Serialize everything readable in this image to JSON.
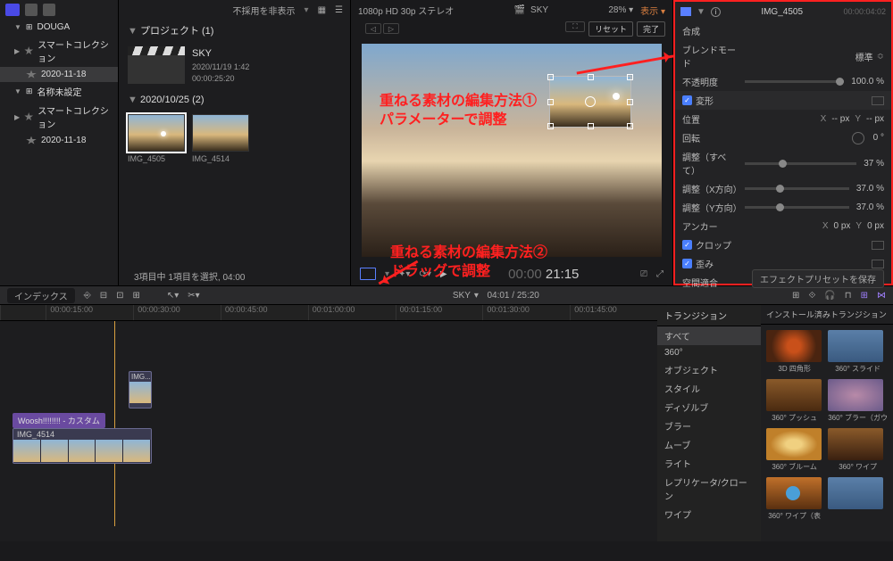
{
  "sidebar": {
    "library": "DOUGA",
    "items": [
      {
        "label": "スマートコレクション",
        "icon": "star"
      },
      {
        "label": "2020-11-18",
        "icon": "star",
        "selected": true
      }
    ],
    "library2": "名称未設定",
    "items2": [
      {
        "label": "スマートコレクション",
        "icon": "star"
      },
      {
        "label": "2020-11-18",
        "icon": "star"
      }
    ]
  },
  "browser": {
    "filter": "不採用を非表示",
    "proj_header": "プロジェクト  (1)",
    "project": {
      "name": "SKY",
      "date": "2020/11/19 1:42",
      "duration": "00:00:25:20"
    },
    "event_header": "2020/10/25  (2)",
    "clips": [
      {
        "name": "IMG_4505",
        "selected": true
      },
      {
        "name": "IMG_4514"
      }
    ],
    "footer": "3項目中 1項目を選択, 04:00"
  },
  "viewer": {
    "format": "1080p HD 30p ステレオ",
    "title": "SKY",
    "zoom": "28%",
    "display_menu": "表示",
    "btn_reset": "リセット",
    "btn_done": "完了",
    "timecode": "21:15",
    "playtime": "00:00",
    "annotation1_l1": "重ねる素材の編集方法①",
    "annotation1_l2": "パラメーターで調整",
    "annotation2_l1": "重ねる素材の編集方法②",
    "annotation2_l2": "ドラッグで調整"
  },
  "inspector": {
    "title": "IMG_4505",
    "timecode": "00:00:04:02",
    "sec_compose": "合成",
    "blend_mode_lbl": "ブレンドモード",
    "blend_mode_val": "標準",
    "opacity_lbl": "不透明度",
    "opacity_val": "100.0 %",
    "sec_transform": "変形",
    "position_lbl": "位置",
    "position_x": "-- px",
    "position_y": "-- px",
    "rotation_lbl": "回転",
    "rotation_val": "0 °",
    "scale_all_lbl": "調整（すべて）",
    "scale_all_val": "37 %",
    "scale_x_lbl": "調整（X方向）",
    "scale_x_val": "37.0 %",
    "scale_y_lbl": "調整（Y方向）",
    "scale_y_val": "37.0 %",
    "anchor_lbl": "アンカー",
    "anchor_x": "0 px",
    "anchor_y": "0 px",
    "sec_crop": "クロップ",
    "sec_distort": "歪み",
    "sec_spatial": "空間適合",
    "save_preset": "エフェクトプリセットを保存"
  },
  "midbar": {
    "index": "インデックス",
    "title": "SKY",
    "position": "04:01 / 25:20"
  },
  "timeline": {
    "ticks": [
      "00:00:15:00",
      "00:00:30:00",
      "00:00:45:00",
      "00:01:00:00",
      "00:01:15:00",
      "00:01:30:00",
      "00:01:45:00"
    ],
    "clip1": "IMG...",
    "tag": "Woosh!!!!!!!! - カスタム",
    "clip2": "IMG_4514"
  },
  "transitions": {
    "header": "トランジション",
    "items": [
      "すべて",
      "360°",
      "オブジェクト",
      "スタイル",
      "ディゾルブ",
      "ブラー",
      "ムーブ",
      "ライト",
      "レプリケータ/クローン",
      "ワイプ"
    ]
  },
  "effects": {
    "header": "インストール済みトランジション",
    "items": [
      {
        "label": "3D 四角形"
      },
      {
        "label": "360° スライド"
      },
      {
        "label": "360° プッシュ"
      },
      {
        "label": "360° ブラー（ガウ"
      },
      {
        "label": "360° ブルーム"
      },
      {
        "label": "360° ワイプ"
      },
      {
        "label": "360° ワイプ（表"
      },
      {
        "label": ""
      }
    ]
  }
}
